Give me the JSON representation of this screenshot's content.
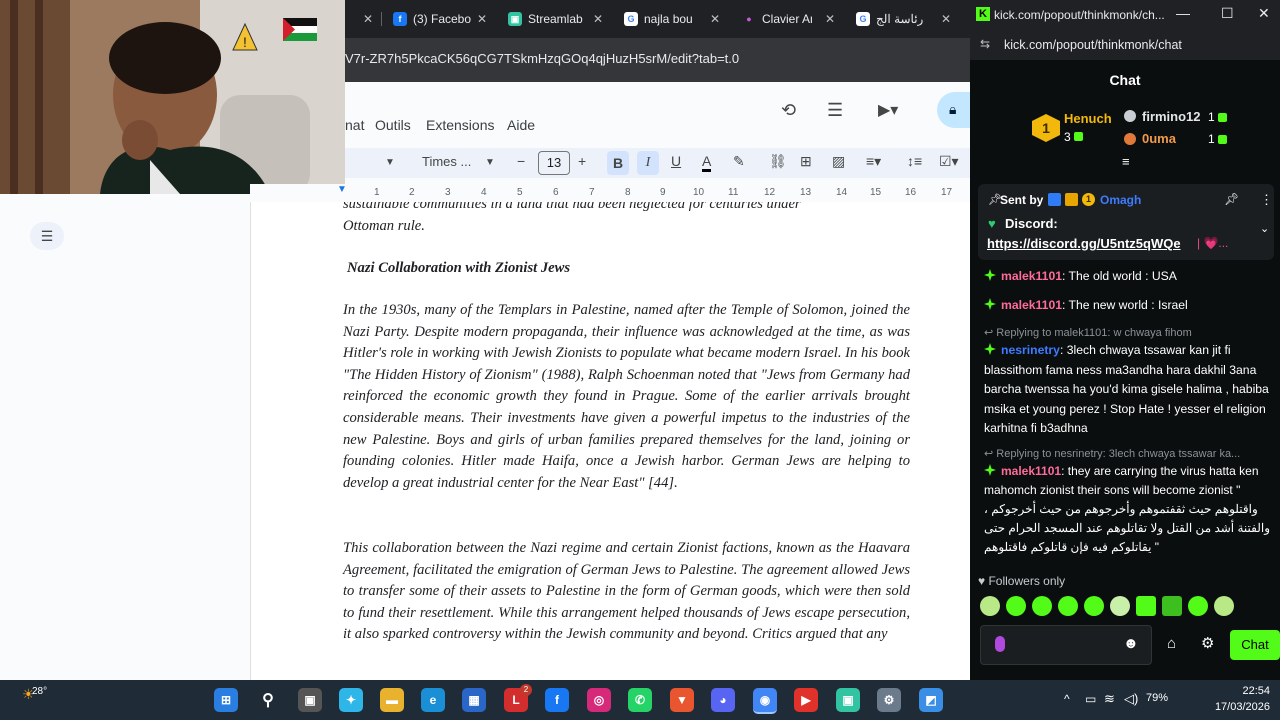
{
  "browser": {
    "tabs": [
      {
        "label": "(3) Facebo",
        "icon": "facebook-icon",
        "color": "#1877f2"
      },
      {
        "label": "Streamlab",
        "icon": "streamlabs-icon",
        "color": "#31c3a2"
      },
      {
        "label": "najla bou",
        "icon": "google-icon",
        "color": "#4285f4"
      },
      {
        "label": "Clavier Ar",
        "icon": "keyboard-icon",
        "color": "#9c27b0"
      },
      {
        "label": "رئاسة الج",
        "icon": "google-icon",
        "color": "#4285f4"
      }
    ],
    "url": "V7r-ZR7h5PkcaCK56qCG7TSkmHzqGOq4qjHuzH5srM/edit?tab=t.0"
  },
  "docs": {
    "menu": [
      "nat",
      "Outils",
      "Extensions",
      "Aide"
    ],
    "toolbar": {
      "font": "Times ...",
      "font_size": "13",
      "minus": "−",
      "plus": "+",
      "bold": "B",
      "italic": "I",
      "underline": "U",
      "text_color": "A"
    },
    "ruler": [
      "1",
      "2",
      "3",
      "4",
      "5",
      "6",
      "7",
      "8",
      "9",
      "10",
      "11",
      "12",
      "13",
      "14",
      "15",
      "16",
      "17"
    ],
    "document": {
      "top_line": "sustainable communities in a land that had been neglected for centuries under",
      "top_line2": "Ottoman rule.",
      "heading": "Nazi Collaboration with Zionist Jews",
      "para1": "In the 1930s, many of the Templars in Palestine, named after the Temple of Solomon, joined the Nazi Party. Despite modern propaganda, their influence was acknowledged at the time, as was Hitler's role in working with Jewish Zionists to populate what became modern Israel. In his book \"The Hidden History of Zionism\" (1988), Ralph Schoenman noted that \"Jews from Germany had reinforced the economic growth they found in Prague. Some of the earlier arrivals brought considerable means. Their investments have given a powerful impetus to the industries of the new Palestine. Boys and girls of urban families prepared themselves for the land, joining or founding colonies. Hitler made Haifa, once a Jewish harbor. German Jews are helping to develop a great industrial center for the Near East\" [44].",
      "para2": "This collaboration between the Nazi regime and certain Zionist factions, known as the Haavara Agreement, facilitated the emigration of German Jews to Palestine. The agreement allowed Jews to transfer some of their assets to Palestine in the form of German goods, which were then sold to fund their resettlement. While this arrangement helped thousands of Jews escape persecution, it also sparked controversy within the Jewish community and beyond. Critics argued that any"
    }
  },
  "chat": {
    "window_title": "kick.com/popout/thinkmonk/ch...",
    "url": "kick.com/popout/thinkmonk/chat",
    "header": "Chat",
    "leaderboard": {
      "first": {
        "name": "Henuch",
        "count": "3",
        "rank": "1"
      },
      "second": {
        "name": "firmino12",
        "count": "1"
      },
      "third": {
        "name": "0uma",
        "count": "1"
      }
    },
    "pinned": {
      "sent_by_label": "Sent by",
      "sender": "Omagh",
      "badge_rank": "1",
      "discord_label": "Discord:",
      "discord_link": "https://discord.gg/U5ntz5qWQe",
      "trailing": "| 💗..."
    },
    "messages": [
      {
        "user": "malek1101",
        "color": "#ff6b9a",
        "text": ": The old world : USA"
      },
      {
        "user": "malek1101",
        "color": "#ff6b9a",
        "text": ": The new world : Israel"
      },
      {
        "reply": "Replying to malek1101: w chwaya fihom"
      },
      {
        "user": "nesrinetry",
        "color": "#3d7bff",
        "text": ": 3lech chwaya tssawar kan jit fi blassithom fama ness ma3andha hara dakhil 3ana barcha twenssa ha you'd kima gisele halima , habiba msika et young perez ! Stop Hate ! yesser el religion karhitna fi b3adhna"
      },
      {
        "reply": "Replying to nesrinetry: 3lech chwaya tssawar ka..."
      },
      {
        "user": "malek1101",
        "color": "#ff6b9a",
        "text": ": they are carrying the virus hatta ken mahomch zionist their sons will become zionist \" واقتلوهم حيث ثقفتموهم وأخرجوهم من حيث أخرجوكم ، والفتنة أشد من القتل ولا تقاتلوهم عند المسجد الحرام حتى يقاتلوكم فيه فإن قاتلوكم فاقتلوهم \""
      }
    ],
    "followers_only": "Followers only",
    "send_button": "Chat",
    "accent": "#53fc18"
  },
  "taskbar": {
    "weather": "28°",
    "time": "22:54",
    "date": "17/03/2026",
    "battery": "79%",
    "badge_count": "2"
  }
}
